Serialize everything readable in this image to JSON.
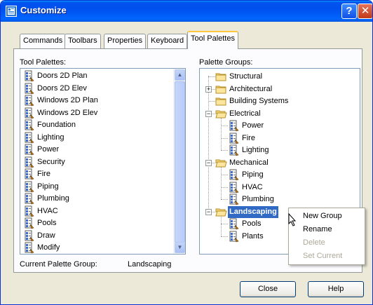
{
  "window": {
    "title": "Customize",
    "help_glyph": "?",
    "close_glyph": "✕"
  },
  "tabs": [
    {
      "label": "Commands"
    },
    {
      "label": "Toolbars"
    },
    {
      "label": "Properties"
    },
    {
      "label": "Keyboard"
    },
    {
      "label": "Tool Palettes",
      "active": true
    }
  ],
  "tool_palettes": {
    "label": "Tool Palettes:",
    "items": [
      "Doors 2D Plan",
      "Doors 2D Elev",
      "Windows 2D Plan",
      "Windows 2D Elev",
      "Foundation",
      "Lighting",
      "Power",
      "Security",
      "Fire",
      "Piping",
      "Plumbing",
      "HVAC",
      "Pools",
      "Draw",
      "Modify"
    ]
  },
  "palette_groups": {
    "label": "Palette Groups:",
    "tree": [
      {
        "label": "Structural",
        "level": 0,
        "type": "folder"
      },
      {
        "label": "Architectural",
        "level": 0,
        "type": "folder",
        "expander": "+"
      },
      {
        "label": "Building Systems",
        "level": 0,
        "type": "folder"
      },
      {
        "label": "Electrical",
        "level": 0,
        "type": "folder-open",
        "expander": "−"
      },
      {
        "label": "Power",
        "level": 1,
        "type": "palette"
      },
      {
        "label": "Fire",
        "level": 1,
        "type": "palette"
      },
      {
        "label": "Lighting",
        "level": 1,
        "type": "palette"
      },
      {
        "label": "Mechanical",
        "level": 0,
        "type": "folder-open",
        "expander": "−"
      },
      {
        "label": "Piping",
        "level": 1,
        "type": "palette"
      },
      {
        "label": "HVAC",
        "level": 1,
        "type": "palette"
      },
      {
        "label": "Plumbing",
        "level": 1,
        "type": "palette"
      },
      {
        "label": "Landscaping",
        "level": 0,
        "type": "folder-open",
        "expander": "−",
        "selected": true
      },
      {
        "label": "Pools",
        "level": 1,
        "type": "palette"
      },
      {
        "label": "Plants",
        "level": 1,
        "type": "palette"
      }
    ]
  },
  "current_group": {
    "label": "Current Palette Group:",
    "value": "Landscaping"
  },
  "context_menu": [
    {
      "label": "New Group",
      "enabled": true
    },
    {
      "label": "Rename",
      "enabled": true
    },
    {
      "label": "Delete",
      "enabled": false
    },
    {
      "label": "Set Current",
      "enabled": false
    }
  ],
  "buttons": {
    "close": "Close",
    "help": "Help"
  },
  "colors": {
    "titlebar": "#0058ee",
    "selection": "#316ac5",
    "dialog_bg": "#ece9d8"
  }
}
